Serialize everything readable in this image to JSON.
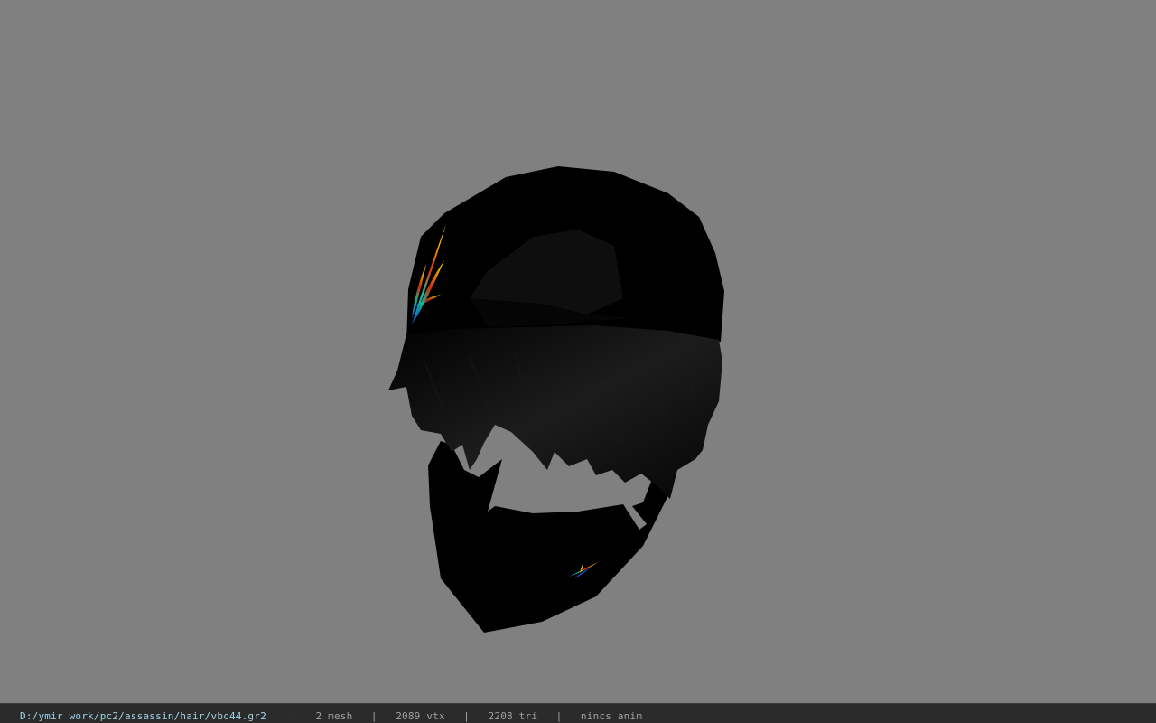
{
  "status_bar": {
    "file_path": "D:/ymir work/pc2/assassin/hair/vbc44.gr2",
    "separator": "|",
    "mesh_count": "2 mesh",
    "vertex_count": "2089 vtx",
    "triangle_count": "2208 tri",
    "animation": "nincs anim"
  },
  "colors": {
    "background": "#808080",
    "status_bar_bg": "#2b2b2b",
    "path_text": "#9fd3e6",
    "stat_text": "#a0a0a0",
    "model": "#000000"
  }
}
